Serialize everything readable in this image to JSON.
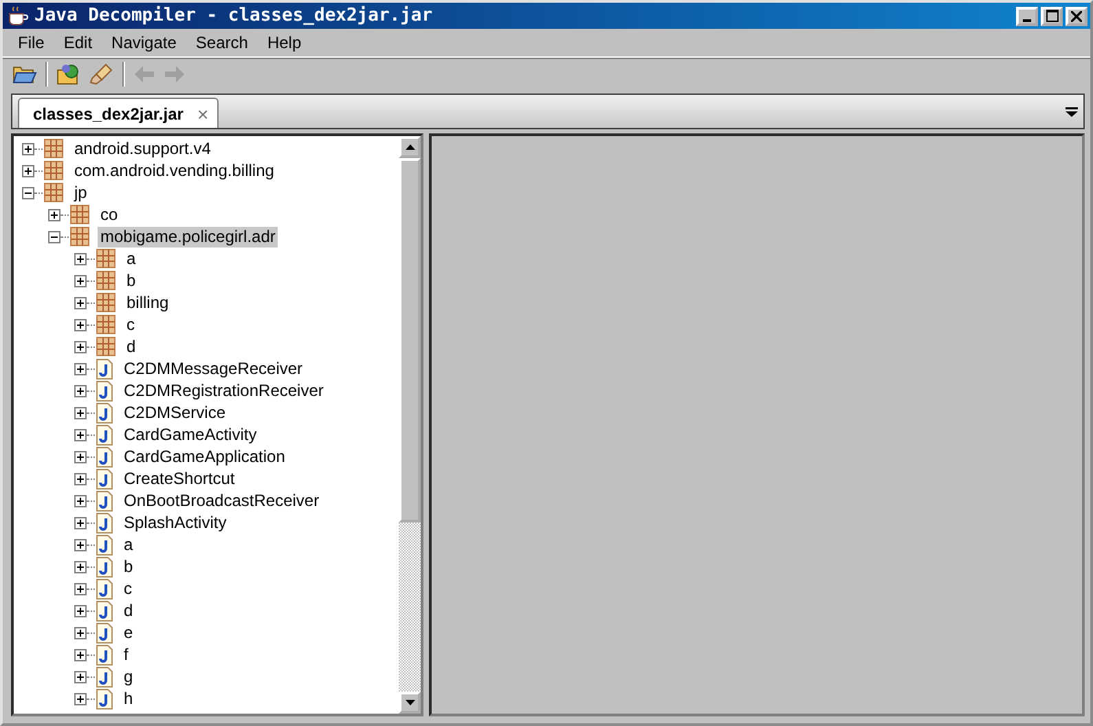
{
  "window": {
    "title": "Java Decompiler - classes_dex2jar.jar"
  },
  "menu": [
    "File",
    "Edit",
    "Navigate",
    "Search",
    "Help"
  ],
  "tabs": [
    {
      "label": "classes_dex2jar.jar",
      "selected": true,
      "close": "×"
    }
  ],
  "tree": [
    {
      "label": "android.support.v4",
      "kind": "package",
      "expanded": false,
      "selected": false
    },
    {
      "label": "com.android.vending.billing",
      "kind": "package",
      "expanded": false,
      "selected": false
    },
    {
      "label": "jp",
      "kind": "package",
      "expanded": true,
      "selected": false,
      "children": [
        {
          "label": "co",
          "kind": "package",
          "expanded": false,
          "selected": false
        },
        {
          "label": "mobigame.policegirl.adr",
          "kind": "package",
          "expanded": true,
          "selected": true,
          "children": [
            {
              "label": "a",
              "kind": "package",
              "expanded": false,
              "selected": false
            },
            {
              "label": "b",
              "kind": "package",
              "expanded": false,
              "selected": false
            },
            {
              "label": "billing",
              "kind": "package",
              "expanded": false,
              "selected": false
            },
            {
              "label": "c",
              "kind": "package",
              "expanded": false,
              "selected": false
            },
            {
              "label": "d",
              "kind": "package",
              "expanded": false,
              "selected": false
            },
            {
              "label": "C2DMMessageReceiver",
              "kind": "class",
              "expanded": false,
              "selected": false
            },
            {
              "label": "C2DMRegistrationReceiver",
              "kind": "class",
              "expanded": false,
              "selected": false
            },
            {
              "label": "C2DMService",
              "kind": "class",
              "expanded": false,
              "selected": false
            },
            {
              "label": "CardGameActivity",
              "kind": "class",
              "expanded": false,
              "selected": false
            },
            {
              "label": "CardGameApplication",
              "kind": "class",
              "expanded": false,
              "selected": false
            },
            {
              "label": "CreateShortcut",
              "kind": "class",
              "expanded": false,
              "selected": false
            },
            {
              "label": "OnBootBroadcastReceiver",
              "kind": "class",
              "expanded": false,
              "selected": false
            },
            {
              "label": "SplashActivity",
              "kind": "class",
              "expanded": false,
              "selected": false
            },
            {
              "label": "a",
              "kind": "class",
              "expanded": false,
              "selected": false
            },
            {
              "label": "b",
              "kind": "class",
              "expanded": false,
              "selected": false
            },
            {
              "label": "c",
              "kind": "class",
              "expanded": false,
              "selected": false
            },
            {
              "label": "d",
              "kind": "class",
              "expanded": false,
              "selected": false
            },
            {
              "label": "e",
              "kind": "class",
              "expanded": false,
              "selected": false
            },
            {
              "label": "f",
              "kind": "class",
              "expanded": false,
              "selected": false
            },
            {
              "label": "g",
              "kind": "class",
              "expanded": false,
              "selected": false
            },
            {
              "label": "h",
              "kind": "class",
              "expanded": false,
              "selected": false
            }
          ]
        }
      ]
    }
  ]
}
